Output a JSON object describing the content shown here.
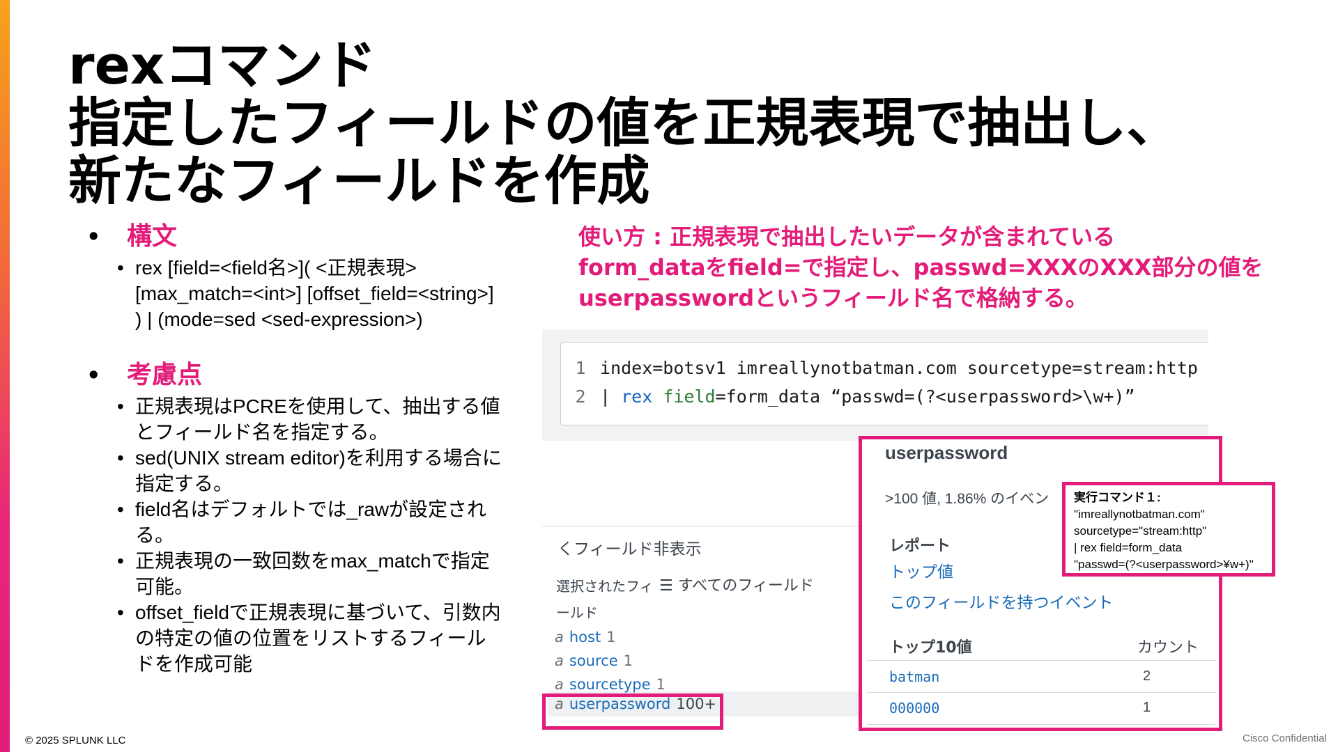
{
  "title": {
    "line1": "rexコマンド",
    "line2": "指定したフィールドの値を正規表現で抽出し、",
    "line3": "新たなフィールドを作成"
  },
  "syntax": {
    "heading": "構文",
    "items": [
      "rex [field=<field名>]( <正規表現> [max_match=<int>] [offset_field=<string>] ) | (mode=sed <sed-expression>)"
    ]
  },
  "considerations": {
    "heading": "考慮点",
    "items": [
      "正規表現はPCREを使用して、抽出する値とフィールド名を指定する。",
      "sed(UNIX stream editor)を利用する場合に指定する。",
      "field名はデフォルトでは_rawが設定される。",
      "正規表現の一致回数をmax_matchで指定可能。",
      "offset_fieldで正規表現に基づいて、引数内の特定の値の位置をリストするフィールドを作成可能"
    ]
  },
  "usage": {
    "line1": "使い方 : 正規表現で抽出したいデータが含まれている",
    "line2": "form_dataをfield=で指定し、passwd=XXXのXXX部分の値を",
    "line3": "userpasswordというフィールド名で格納する。"
  },
  "search": {
    "line1_num": "1",
    "line1_text": "index=botsv1 imreallynotbatman.com sourcetype=stream:http",
    "line2_num": "2",
    "line2_pipe": "| ",
    "line2_rex": "rex",
    "line2_field": "field",
    "line2_rest": "=form_data “passwd=(?<userpassword>\\w+)”"
  },
  "fields_sidebar": {
    "hide_label": "くフィールド非表示",
    "all_fields": "☰ すべてのフィールド",
    "selected_label": "選択されたフィールド",
    "fields": [
      {
        "type": "a",
        "name": "host",
        "count": "1"
      },
      {
        "type": "a",
        "name": "source",
        "count": "1"
      },
      {
        "type": "a",
        "name": "sourcetype",
        "count": "1"
      },
      {
        "type": "a",
        "name": "userpassword",
        "count": "100+"
      }
    ]
  },
  "field_popup": {
    "title": "userpassword",
    "stats": ">100 値, 1.86% のイベン",
    "report_heading": "レポート",
    "top_values_link": "トップ値",
    "events_link": "このフィールドを持つイベント",
    "top10_heading": "トップ10値",
    "count_heading": "カウント",
    "values": [
      {
        "value": "batman",
        "count": "2"
      },
      {
        "value": "000000",
        "count": "1"
      }
    ]
  },
  "exec_command": {
    "heading": "実行コマンド１:",
    "lines": [
      "\"imreallynotbatman.com\"",
      "sourcetype=\"stream:http\"",
      "| rex field=form_data",
      "\"passwd=(?<userpassword>¥w+)\""
    ]
  },
  "footer": {
    "copyright": "© 2025 SPLUNK LLC",
    "confidential": "Cisco Confidential"
  },
  "colors": {
    "accent": "#e31c79",
    "link": "#1a6bb8"
  }
}
